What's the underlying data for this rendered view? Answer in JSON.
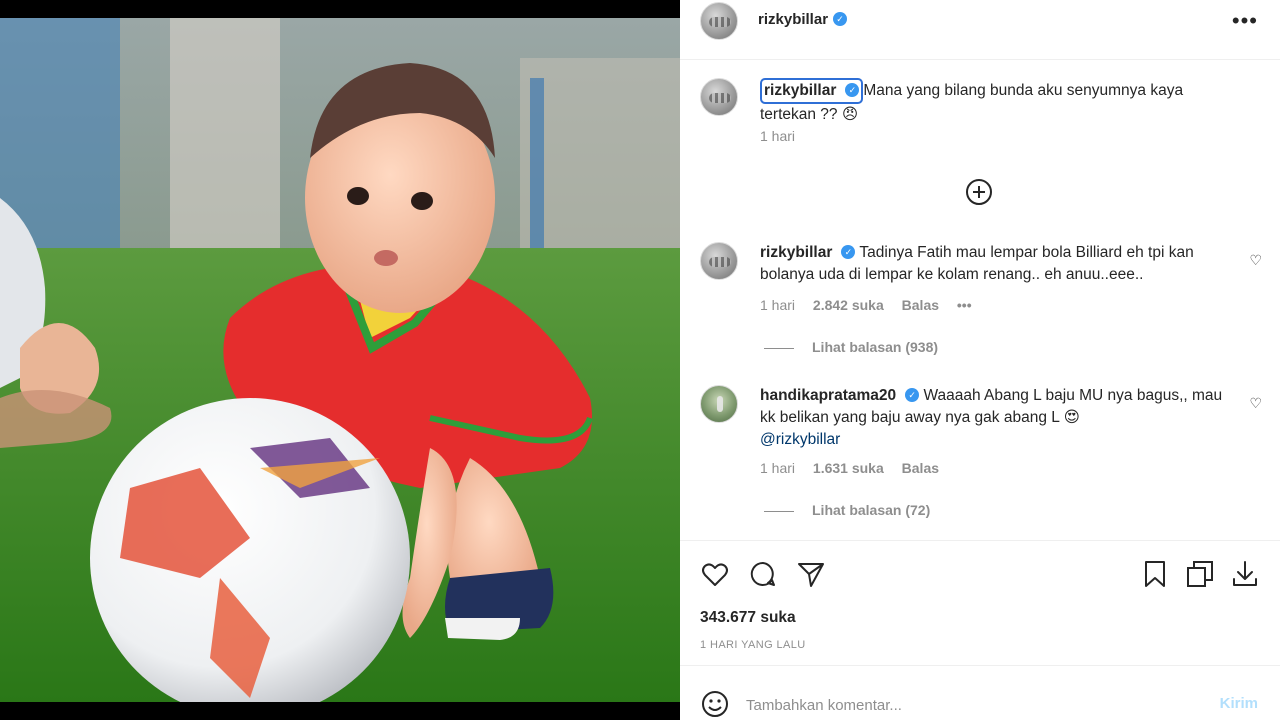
{
  "post": {
    "username": "rizkybillar",
    "more_icon": "more-horizontal-icon",
    "caption": {
      "username": "rizkybillar",
      "text": "Mana yang bilang bunda aku senyumnya kaya tertekan ?? 😠",
      "time": "1 hari"
    },
    "load_more_icon": "plus-circle-icon",
    "comments": [
      {
        "username": "rizkybillar",
        "text": "Tadinya Fatih mau lempar bola Billiard eh tpi kan bolanya uda di lempar ke kolam renang.. eh anuu..eee..",
        "time": "1 hari",
        "likes": "2.842 suka",
        "reply": "Balas",
        "options": "•••",
        "view_replies": "Lihat balasan (938)"
      },
      {
        "username": "handikapratama20",
        "text": "Waaaah Abang L baju MU nya bagus,, mau kk belikan yang baju away nya gak abang L 😍",
        "mention": "@rizkybillar",
        "time": "1 hari",
        "likes": "1.631 suka",
        "reply": "Balas",
        "view_replies": "Lihat balasan (72)"
      }
    ],
    "actions": {
      "left": [
        "heart-icon",
        "comment-icon",
        "share-icon"
      ],
      "right": [
        "bookmark-icon",
        "copy-icon",
        "download-icon"
      ]
    },
    "like_count": "343.677 suka",
    "date": "1 HARI YANG LALU",
    "add_comment": {
      "placeholder": "Tambahkan komentar...",
      "post_label": "Kirim"
    }
  },
  "colors": {
    "verified": "#3897f0",
    "muted": "#8e8e8e",
    "post_disabled": "#b2dffc",
    "highlight_box": "#2f6fd6"
  }
}
